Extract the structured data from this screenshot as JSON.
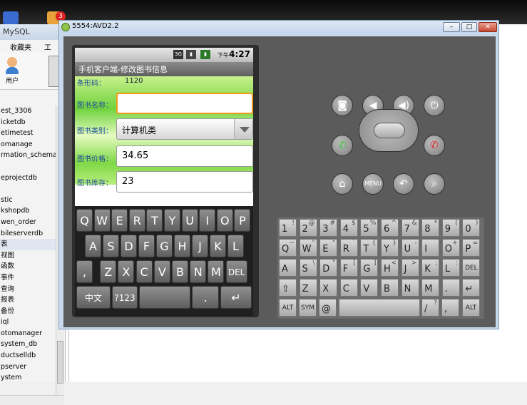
{
  "taskbar": {
    "badge": "3"
  },
  "mysql": {
    "title": "MySQL",
    "menu": [
      "收藏夹",
      "工具"
    ],
    "toolbar_user": "用户",
    "tree": [
      "est_3306",
      "icketdb",
      "etimetest",
      "omanage",
      "rmation_schema",
      "",
      "eprojectdb",
      "",
      "stic",
      "kshopdb",
      "wen_order",
      "bileserverdb",
      "表",
      "视图",
      "函数",
      "事件",
      "查询",
      "报表",
      "备份",
      "iql",
      "otomanager",
      "system_db",
      "ductselldb",
      "pserver",
      "ystem"
    ]
  },
  "emulator": {
    "title": "5554:AVD2.2",
    "status": {
      "ampm": "下午",
      "time": "4:27"
    },
    "app_title": "手机客户端-修改图书信息",
    "barcode_label": "条形码：",
    "barcode_value": "1120",
    "name_label": "图书名称：",
    "name_value": "",
    "category_label": "图书类别：",
    "category_value": "计算机类",
    "price_label": "图书价格：",
    "price_value": "34.65",
    "stock_label": "图书库存：",
    "stock_value": "23",
    "soft_keys": {
      "row1": [
        "Q",
        "W",
        "E",
        "R",
        "T",
        "Y",
        "U",
        "I",
        "O",
        "P"
      ],
      "row2": [
        "A",
        "S",
        "D",
        "F",
        "G",
        "H",
        "J",
        "K",
        "L"
      ],
      "row3": [
        ",",
        "Z",
        "X",
        "C",
        "V",
        "B",
        "N",
        "M",
        "DEL"
      ],
      "row4": [
        "中文",
        "?123",
        "",
        ".",
        "↵"
      ]
    },
    "hw_keys": {
      "row1": [
        [
          "1",
          "!"
        ],
        [
          "2",
          "@"
        ],
        [
          "3",
          "#"
        ],
        [
          "4",
          "$"
        ],
        [
          "5",
          "%"
        ],
        [
          "6",
          "^"
        ],
        [
          "7",
          "&"
        ],
        [
          "8",
          "*"
        ],
        [
          "9",
          "("
        ],
        [
          "0",
          ")"
        ]
      ],
      "row2": [
        [
          "Q",
          "~"
        ],
        [
          "W",
          "\""
        ],
        [
          "E",
          "\""
        ],
        [
          "R",
          "`"
        ],
        [
          "T",
          "{"
        ],
        [
          "Y",
          "}"
        ],
        [
          "U",
          "-"
        ],
        [
          "I",
          ""
        ],
        [
          "O",
          "+"
        ],
        [
          "P",
          "="
        ]
      ],
      "row3": [
        [
          "A",
          ""
        ],
        [
          "S",
          "\\"
        ],
        [
          "D",
          "\""
        ],
        [
          "F",
          "["
        ],
        [
          "G",
          "]"
        ],
        [
          "H",
          "<"
        ],
        [
          "J",
          ">"
        ],
        [
          "K",
          ";"
        ],
        [
          "L",
          ":"
        ],
        [
          "DEL",
          ""
        ]
      ],
      "row4": [
        [
          "⇧",
          ""
        ],
        [
          "Z",
          ""
        ],
        [
          "X",
          ""
        ],
        [
          "C",
          ""
        ],
        [
          "V",
          ""
        ],
        [
          "B",
          ""
        ],
        [
          "N",
          ""
        ],
        [
          "M",
          ""
        ],
        [
          ".",
          ""
        ],
        [
          "↵",
          ""
        ]
      ],
      "row5": [
        [
          "ALT",
          ""
        ],
        [
          "SYM",
          ""
        ],
        [
          "@",
          ""
        ],
        [
          "",
          ""
        ],
        [
          "/",
          "?"
        ],
        [
          ",",
          ""
        ],
        [
          "ALT",
          ""
        ]
      ]
    }
  }
}
